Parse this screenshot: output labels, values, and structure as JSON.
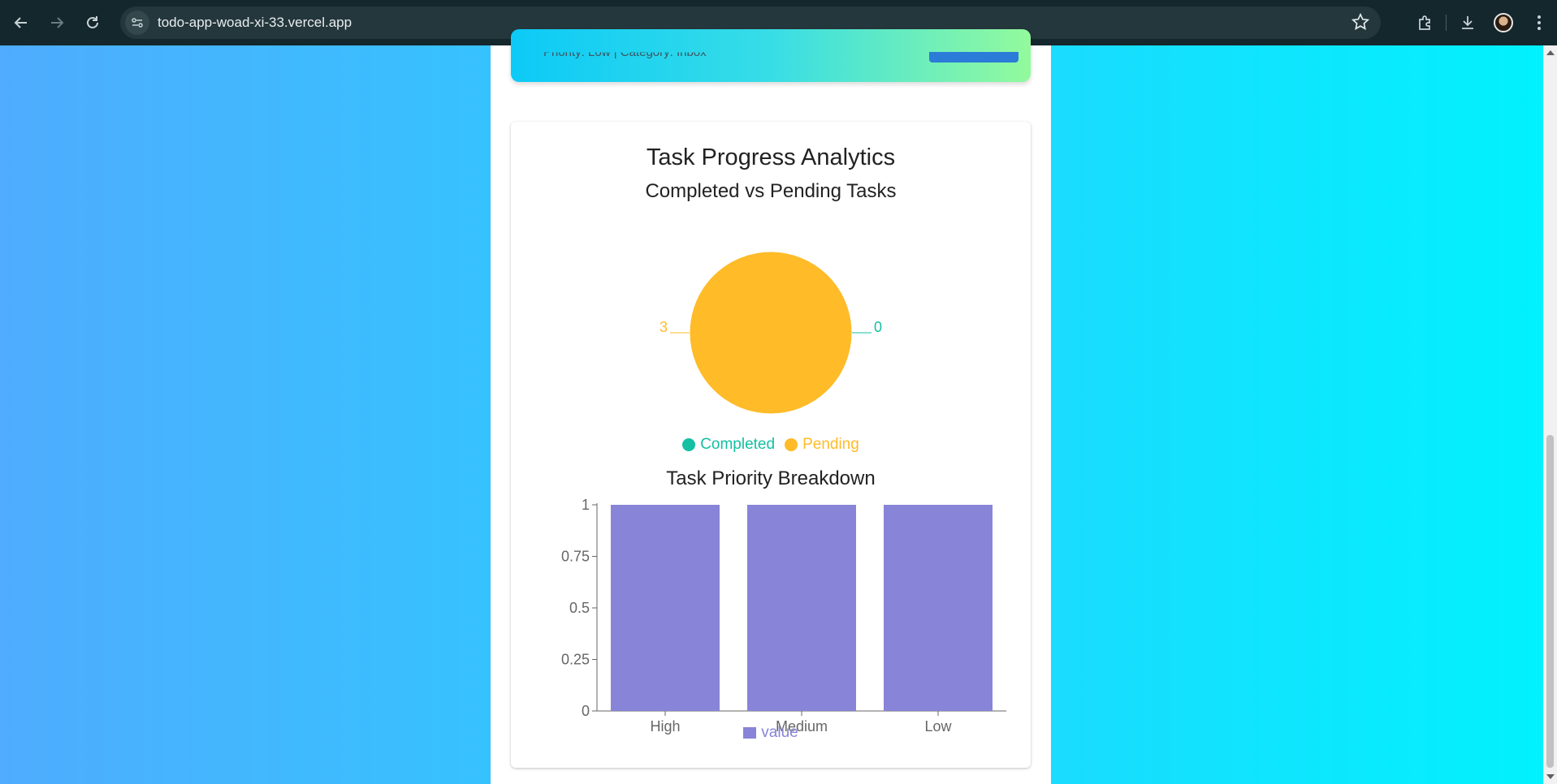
{
  "browser": {
    "url": "todo-app-woad-xi-33.vercel.app",
    "icons": [
      "back-arrow-icon",
      "forward-arrow-icon",
      "reload-icon",
      "site-info-icon",
      "bookmark-star-icon",
      "extensions-icon",
      "download-icon",
      "profile-avatar",
      "menu-kebab-icon"
    ]
  },
  "task_card": {
    "meta_text": "Priority: Low | Category: Inbox"
  },
  "analytics": {
    "title": "Task Progress Analytics"
  },
  "colors": {
    "completed": "#13c0a3",
    "pending": "#ffbb28",
    "bar": "#8884d8",
    "axis": "#666666"
  },
  "chart_data": [
    {
      "type": "pie",
      "title": "Completed vs Pending Tasks",
      "slices": [
        {
          "name": "Completed",
          "value": 0
        },
        {
          "name": "Pending",
          "value": 3
        }
      ],
      "legend": "bottom"
    },
    {
      "type": "bar",
      "title": "Task Priority Breakdown",
      "categories": [
        "High",
        "Medium",
        "Low"
      ],
      "series": [
        {
          "name": "value",
          "values": [
            1,
            1,
            1
          ]
        }
      ],
      "ylim": [
        0,
        1
      ],
      "yticks": [
        "0",
        "0.25",
        "0.5",
        "0.75",
        "1"
      ],
      "legend": "bottom",
      "grid": false
    }
  ]
}
